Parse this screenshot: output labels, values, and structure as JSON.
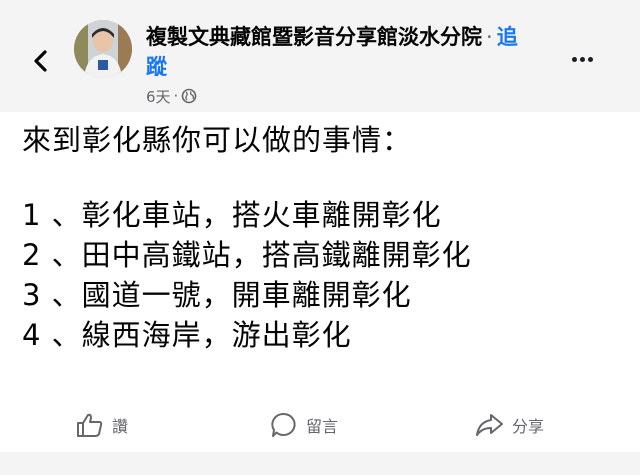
{
  "post": {
    "author": "複製文典藏館暨影音分享館淡水分院",
    "separator": "·",
    "follow_label": "追蹤",
    "timestamp": "6天",
    "meta_separator": "·",
    "privacy_icon": "globe-icon",
    "back_icon": "chevron-left-icon",
    "more_icon": "more-horizontal-icon",
    "body": {
      "heading": "來到彰化縣你可以做的事情：",
      "items": [
        "1 、彰化車站，搭火車離開彰化",
        "2 、田中高鐵站，搭高鐵離開彰化",
        "3 、國道一號，開車離開彰化",
        "4 、線西海岸，游出彰化"
      ]
    }
  },
  "actions": {
    "like_label": "讚",
    "comment_label": "留言",
    "share_label": "分享"
  },
  "colors": {
    "header_background": "#f4f4f5",
    "link": "#1877f2",
    "secondary_text": "#65676b"
  }
}
